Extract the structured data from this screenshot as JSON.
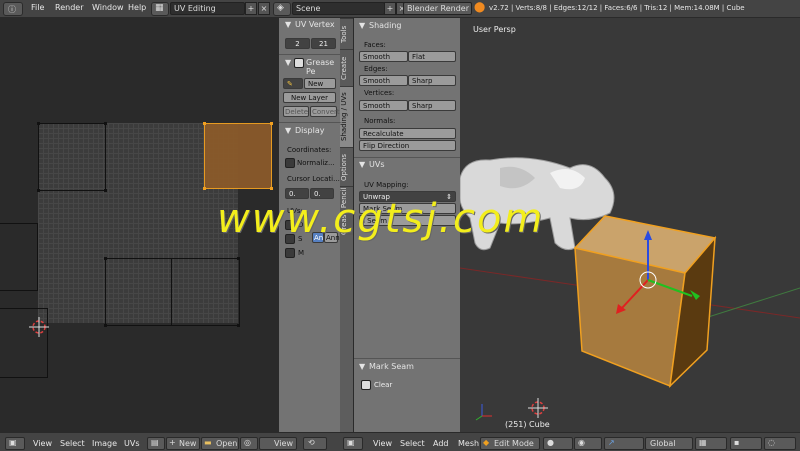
{
  "topbar": {
    "menus": [
      "File",
      "Render",
      "Window",
      "Help"
    ],
    "screen_layout": "UV Editing",
    "scene": "Scene",
    "render_engine": "Blender Render",
    "stats": "v2.72 | Verts:8/8 | Edges:12/12 | Faces:6/6 | Tris:12 | Mem:14.08M | Cube"
  },
  "uv_panel": {
    "uv_vertex_title": "UV Vertex",
    "uv_vertex_x": "2",
    "uv_vertex_y": "21",
    "grease_title": "Grease Pe",
    "new_label": "New",
    "new_layer": "New Layer",
    "delete_label": "Delete",
    "convert_label": "Convert",
    "display_title": "Display",
    "coordinates_label": "Coordinates:",
    "normalize_label": "Normaliz...",
    "cursor_label": "Cursor Locati...",
    "cursor_x": "0.",
    "cursor_y": "0.",
    "uvs_label": "UVs:",
    "uv_rows": [
      "D",
      "S",
      "M"
    ],
    "an_label": "An",
    "ann_label": "Ann"
  },
  "tabs": [
    "Tools",
    "Create",
    "Shading / UVs",
    "Options",
    "Grease Pencil"
  ],
  "shading_panel": {
    "shading_title": "Shading",
    "faces_label": "Faces:",
    "edges_label": "Edges:",
    "vertices_label": "Vertices:",
    "smooth_label": "Smooth",
    "flat_label": "Flat",
    "sharp_label": "Sharp",
    "normals_label": "Normals:",
    "recalculate": "Recalculate",
    "flip_direction": "Flip Direction",
    "uvs_title": "UVs",
    "uv_mapping_label": "UV Mapping:",
    "unwrap": "Unwrap",
    "mark_seam": "Mark Seam",
    "clear_seam": "l Seam",
    "op_title": "Mark Seam",
    "clear_label": "Clear"
  },
  "viewport": {
    "view_label": "User Persp",
    "object_label": "(251) Cube"
  },
  "bottombar": {
    "uv_menus": [
      "View",
      "Select",
      "Image",
      "UVs"
    ],
    "new_label": "New",
    "open_label": "Open",
    "view_label": "View",
    "view3d_menus": [
      "View",
      "Select",
      "Add",
      "Mesh"
    ],
    "mode": "Edit Mode",
    "orientation": "Global"
  },
  "watermark": "www.cgtsj.com",
  "colors": {
    "accent_orange": "#f0a020",
    "selected_face": "#8a5a2a",
    "watermark": "#f3ee1c",
    "panel_bg": "#737373"
  }
}
